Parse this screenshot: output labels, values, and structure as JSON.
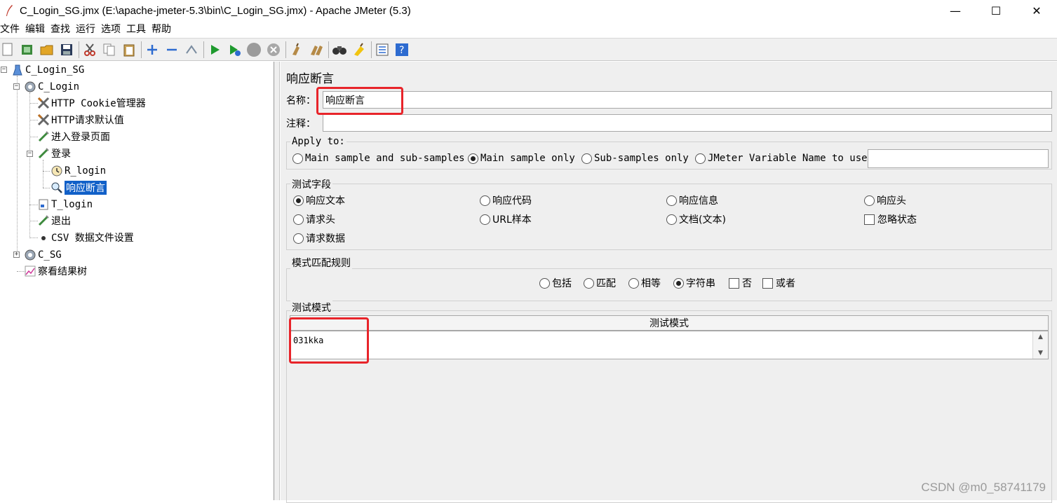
{
  "window": {
    "title": "C_Login_SG.jmx (E:\\apache-jmeter-5.3\\bin\\C_Login_SG.jmx) - Apache JMeter (5.3)",
    "minimize": "—",
    "maximize": "☐",
    "close": "✕"
  },
  "menu": [
    "文件",
    "编辑",
    "查找",
    "运行",
    "选项",
    "工具",
    "帮助"
  ],
  "toolbar": [
    "new-icon",
    "templates-icon",
    "open-icon",
    "save-icon",
    "cut-icon",
    "copy-icon",
    "paste-icon",
    "expand-icon",
    "collapse-icon",
    "toggle-icon",
    "start-icon",
    "start-no-pause-icon",
    "stop-icon",
    "shutdown-icon",
    "clear-icon",
    "clear-all-icon",
    "search-icon",
    "reset-search-icon",
    "function-helper-icon",
    "help-icon"
  ],
  "tree": {
    "items": [
      {
        "label": "C_Login_SG",
        "icon": "test-plan-icon"
      },
      {
        "label": "C_Login",
        "icon": "thread-group-icon"
      },
      {
        "label": "HTTP Cookie管理器",
        "icon": "config-element-icon"
      },
      {
        "label": "HTTP请求默认值",
        "icon": "config-element-icon"
      },
      {
        "label": "进入登录页面",
        "icon": "sampler-icon"
      },
      {
        "label": "登录",
        "icon": "sampler-icon"
      },
      {
        "label": "R_login",
        "icon": "timer-icon"
      },
      {
        "label": "响应断言",
        "icon": "assertion-icon"
      },
      {
        "label": "T_login",
        "icon": "transaction-icon"
      },
      {
        "label": "退出",
        "icon": "sampler-icon"
      },
      {
        "label": "CSV 数据文件设置",
        "icon": "dot-icon"
      },
      {
        "label": "C_SG",
        "icon": "thread-group-icon"
      },
      {
        "label": "察看结果树",
        "icon": "listener-icon"
      }
    ]
  },
  "panel": {
    "title": "响应断言",
    "name_label": "名称：",
    "name_value": "响应断言",
    "comment_label": "注释：",
    "comment_value": "",
    "apply_to": {
      "title": "Apply to:",
      "options": [
        "Main sample and sub-samples",
        "Main sample only",
        "Sub-samples only",
        "JMeter Variable Name to use"
      ],
      "selected": "Main sample only",
      "variable_value": ""
    },
    "test_field": {
      "title": "测试字段",
      "options": [
        "响应文本",
        "响应代码",
        "响应信息",
        "响应头",
        "请求头",
        "URL样本",
        "文档(文本)",
        "忽略状态",
        "请求数据"
      ],
      "selected": "响应文本",
      "ignore_status_checked": false
    },
    "pattern_rules": {
      "title": "模式匹配规则",
      "options": [
        "包括",
        "匹配",
        "相等",
        "字符串"
      ],
      "selected": "字符串",
      "not_label": "否",
      "or_label": "或者",
      "not_checked": false,
      "or_checked": false
    },
    "patterns": {
      "title": "测试模式",
      "column_header": "测试模式",
      "rows": [
        "031kka"
      ]
    }
  },
  "watermark": "CSDN @m0_58741179"
}
